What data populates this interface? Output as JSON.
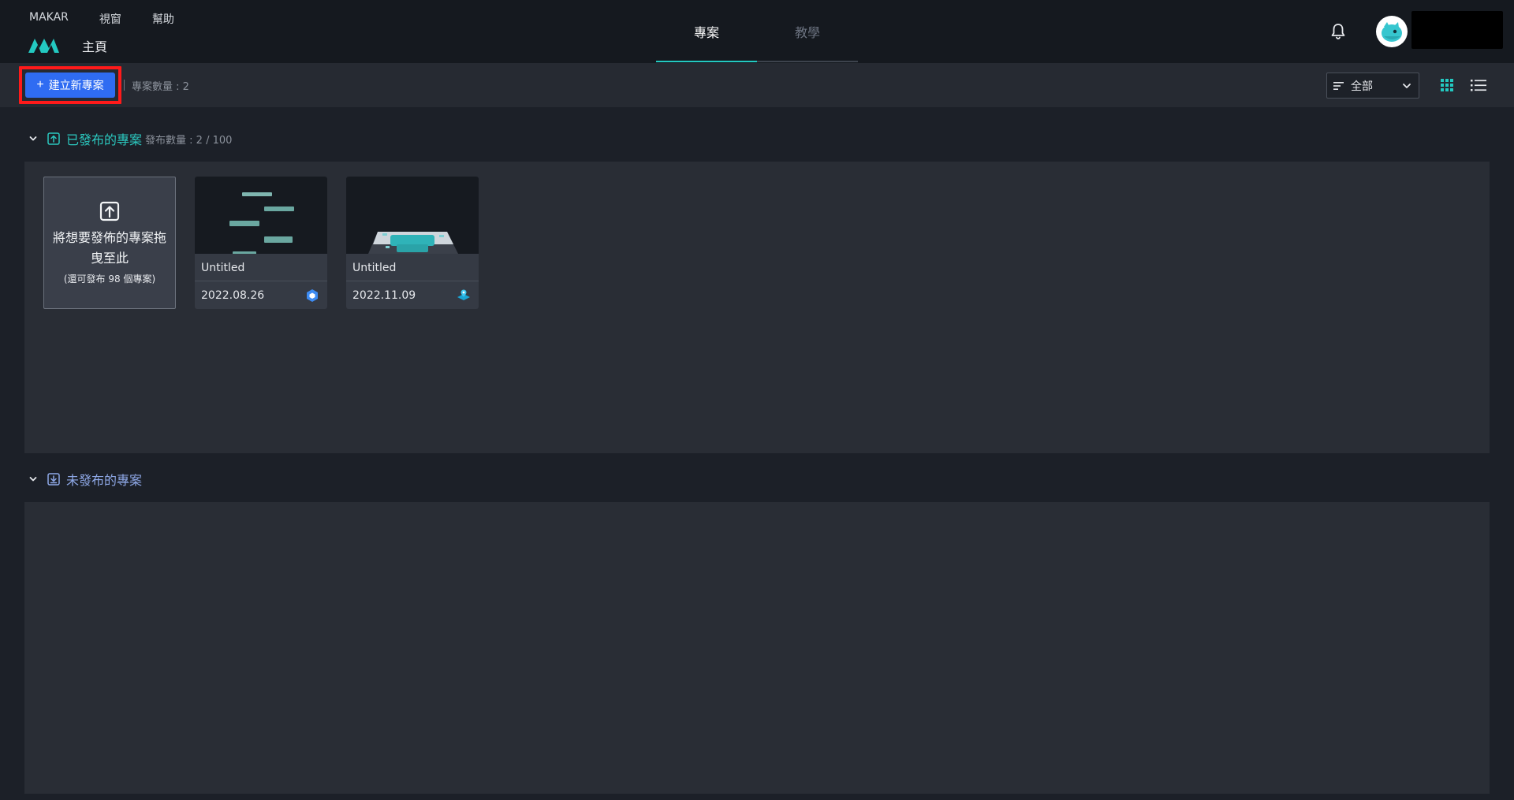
{
  "menu": {
    "items": [
      "MAKAR",
      "視窗",
      "幫助"
    ]
  },
  "header": {
    "home_label": "主頁"
  },
  "tabs": [
    {
      "label": "專案",
      "active": true
    },
    {
      "label": "教學",
      "active": false
    }
  ],
  "toolbar": {
    "create_label": "建立新專案",
    "project_count": "專案數量 : 2",
    "filter_value": "全部"
  },
  "published": {
    "title": "已發布的專案",
    "count": "發布數量 : 2 / 100",
    "drop_text": "將想要發佈的專案拖曳至此",
    "drop_sub": "(還可發布 98 個專案)",
    "cards": [
      {
        "name": "Untitled",
        "date": "2022.08.26",
        "type_icon": "ar-cube-icon"
      },
      {
        "name": "Untitled",
        "date": "2022.11.09",
        "type_icon": "ar-location-icon"
      }
    ]
  },
  "unpublished": {
    "title": "未發布的專案"
  },
  "colors": {
    "accent": "#23c9c1",
    "primary_button": "#2f6cf2",
    "highlight": "#ff1a1a"
  }
}
